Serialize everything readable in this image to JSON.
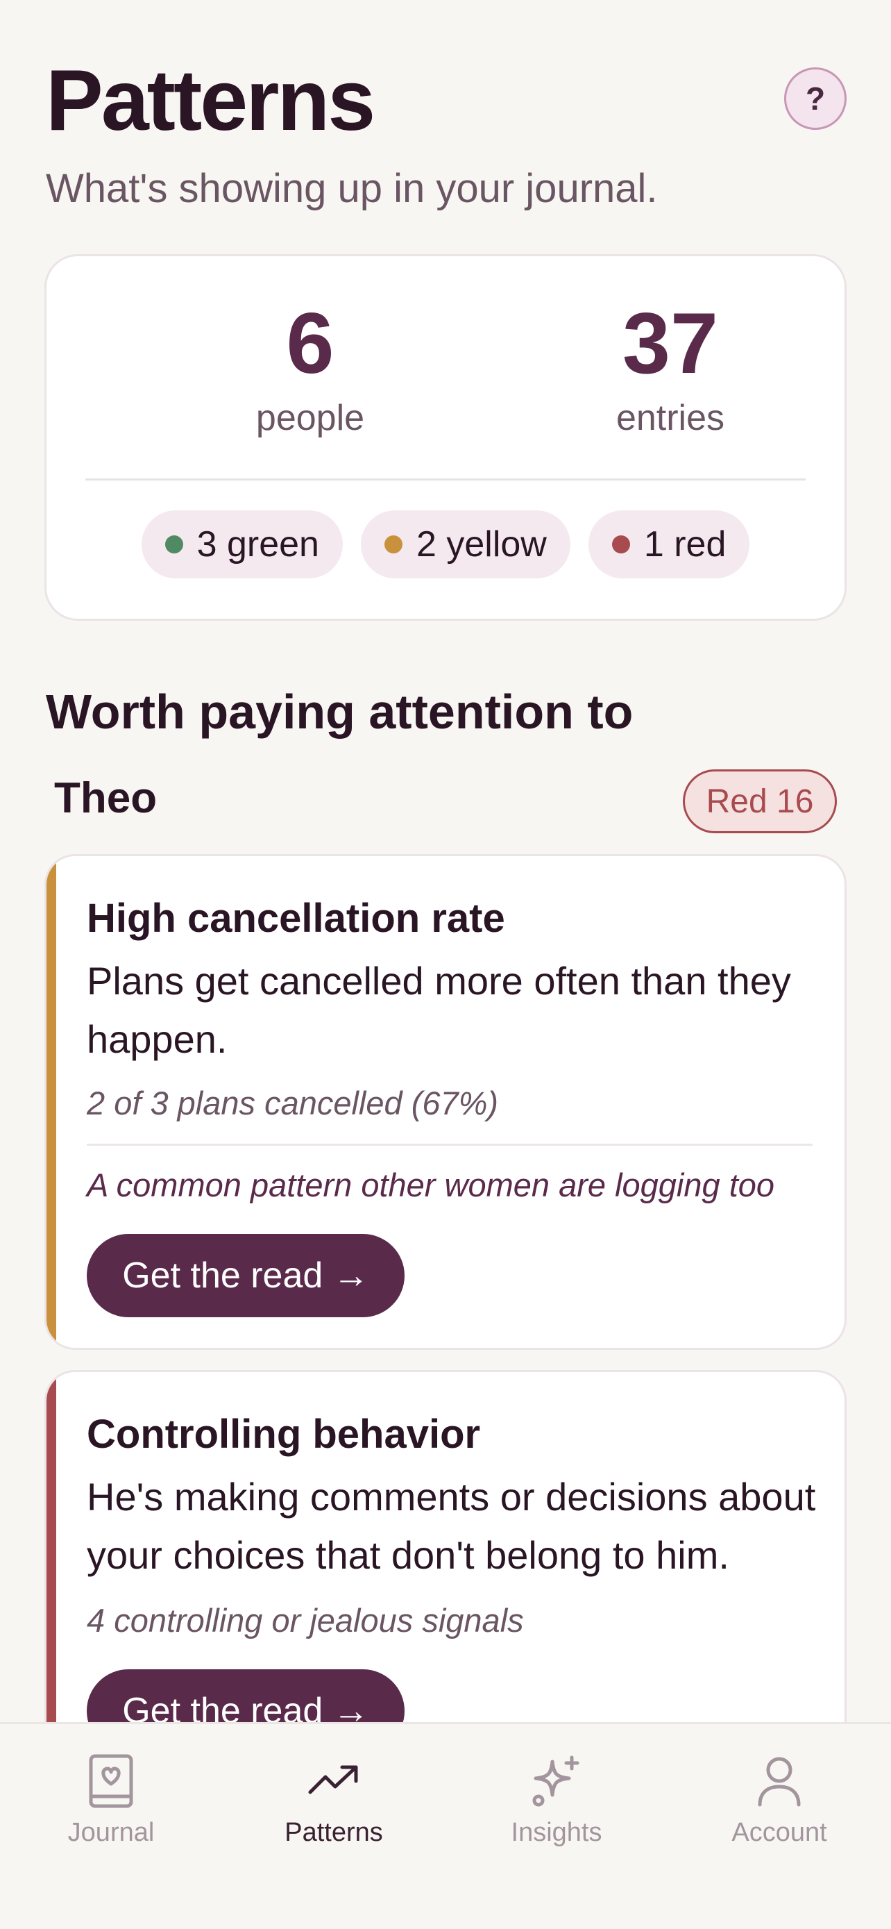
{
  "header": {
    "title": "Patterns",
    "subtitle": "What's showing up in your journal.",
    "help_label": "?"
  },
  "stats": {
    "people_count": "6",
    "people_label": "people",
    "entries_count": "37",
    "entries_label": "entries",
    "pills": [
      {
        "label": "3 green",
        "color": "#4f8a63"
      },
      {
        "label": "2 yellow",
        "color": "#c9913c"
      },
      {
        "label": "1 red",
        "color": "#a74b4f"
      }
    ]
  },
  "section": {
    "title": "Worth paying attention to",
    "person": "Theo",
    "badge": "Red 16"
  },
  "cards": [
    {
      "accent": "#c9913c",
      "title": "High cancellation rate",
      "description": "Plans get cancelled more often than they happen.",
      "stat": "2 of 3 plans cancelled (67%)",
      "note": "A common pattern other women are logging too",
      "button": "Get the read →"
    },
    {
      "accent": "#a74b4f",
      "title": "Controlling behavior",
      "description": "He's making comments or decisions about your choices that don't belong to him.",
      "stat": "4 controlling or jealous signals",
      "button": "Get the read →"
    }
  ],
  "tabs": [
    {
      "label": "Journal",
      "icon": "journal-heart-icon",
      "active": false
    },
    {
      "label": "Patterns",
      "icon": "trend-up-icon",
      "active": true
    },
    {
      "label": "Insights",
      "icon": "sparkle-icon",
      "active": false
    },
    {
      "label": "Account",
      "icon": "person-icon",
      "active": false
    }
  ]
}
